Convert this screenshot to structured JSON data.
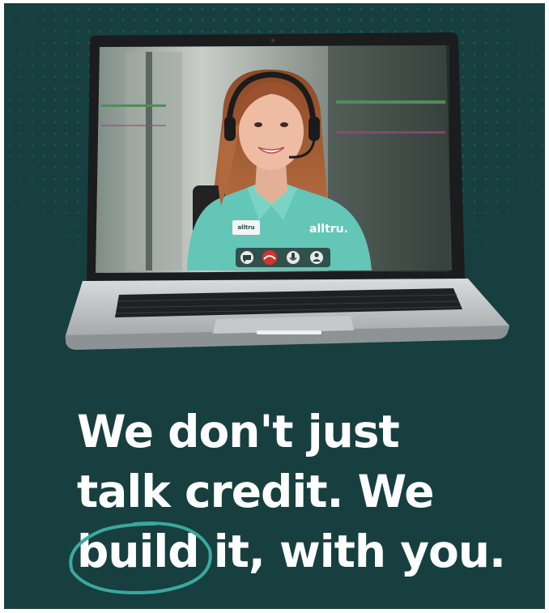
{
  "headline": {
    "line1": "We don't just",
    "line2": "talk credit. We",
    "line3_circled": "build",
    "line3_rest": " it, with you."
  },
  "video_call": {
    "shirt_brand": "alltru.",
    "name_badge": "alltru",
    "controls": [
      "chat-icon",
      "hang-up-icon",
      "microphone-icon",
      "user-icon"
    ]
  },
  "colors": {
    "background": "#173f3f",
    "accent_teal": "#3aa9a0",
    "hangup_red": "#d7322c",
    "shirt": "#63c6b7",
    "text": "#ffffff"
  }
}
